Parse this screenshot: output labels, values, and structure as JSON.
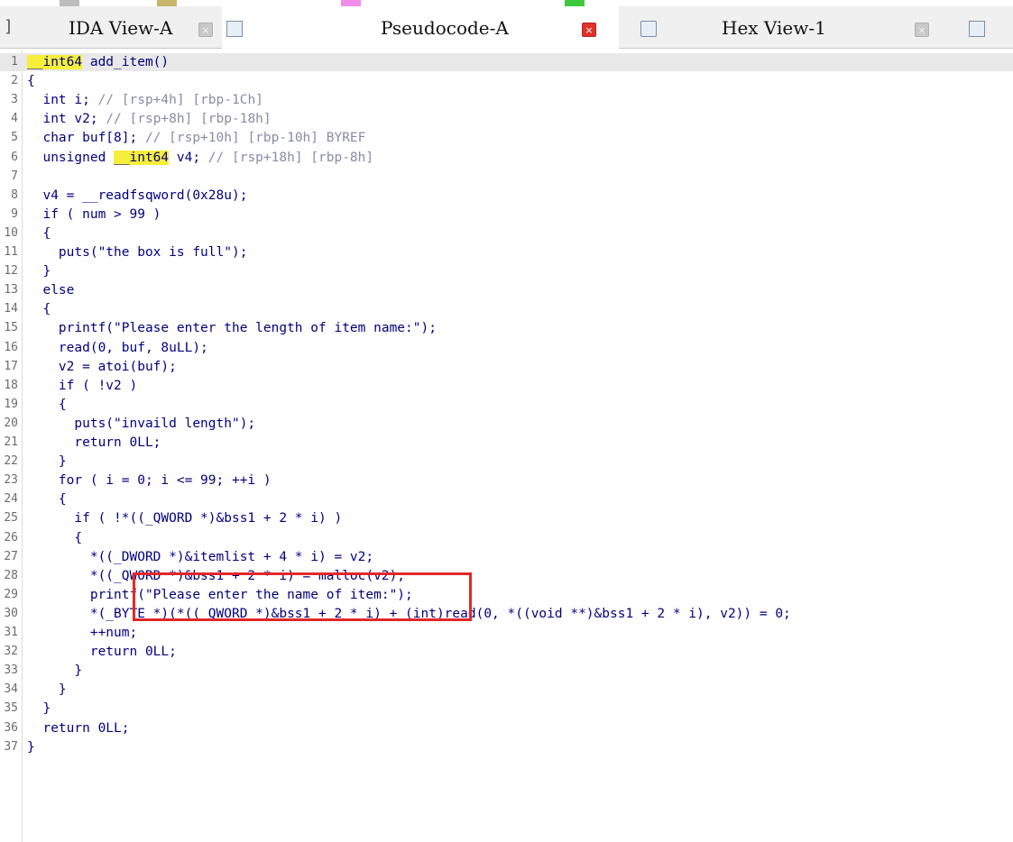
{
  "tabs": [
    {
      "label": "IDA View-A",
      "active": false,
      "close": "×"
    },
    {
      "label": "Pseudocode-A",
      "active": true,
      "close": "×"
    },
    {
      "label": "Hex View-1",
      "active": false,
      "close": "×"
    }
  ],
  "colors": {
    "accent_close": "#e0322a",
    "highlight": "#f5ee3a",
    "code_text": "#000080",
    "comment": "#8a8aa8",
    "annotation_box": "#e22828"
  },
  "code_lines": [
    {
      "num": "1",
      "text": "__int64 add_item()"
    },
    {
      "num": "2",
      "text": "{"
    },
    {
      "num": "3",
      "text": "  int i; // [rsp+4h] [rbp-1Ch]"
    },
    {
      "num": "4",
      "text": "  int v2; // [rsp+8h] [rbp-18h]"
    },
    {
      "num": "5",
      "text": "  char buf[8]; // [rsp+10h] [rbp-10h] BYREF"
    },
    {
      "num": "6",
      "text": "  unsigned __int64 v4; // [rsp+18h] [rbp-8h]"
    },
    {
      "num": "7",
      "text": ""
    },
    {
      "num": "8",
      "text": "  v4 = __readfsqword(0x28u);"
    },
    {
      "num": "9",
      "text": "  if ( num > 99 )"
    },
    {
      "num": "10",
      "text": "  {"
    },
    {
      "num": "11",
      "text": "    puts(\"the box is full\");"
    },
    {
      "num": "12",
      "text": "  }"
    },
    {
      "num": "13",
      "text": "  else"
    },
    {
      "num": "14",
      "text": "  {"
    },
    {
      "num": "15",
      "text": "    printf(\"Please enter the length of item name:\");"
    },
    {
      "num": "16",
      "text": "    read(0, buf, 8uLL);"
    },
    {
      "num": "17",
      "text": "    v2 = atoi(buf);"
    },
    {
      "num": "18",
      "text": "    if ( !v2 )"
    },
    {
      "num": "19",
      "text": "    {"
    },
    {
      "num": "20",
      "text": "      puts(\"invaild length\");"
    },
    {
      "num": "21",
      "text": "      return 0LL;"
    },
    {
      "num": "22",
      "text": "    }"
    },
    {
      "num": "23",
      "text": "    for ( i = 0; i <= 99; ++i )"
    },
    {
      "num": "24",
      "text": "    {"
    },
    {
      "num": "25",
      "text": "      if ( !*((_QWORD *)&bss1 + 2 * i) )"
    },
    {
      "num": "26",
      "text": "      {"
    },
    {
      "num": "27",
      "text": "        *((_DWORD *)&itemlist + 4 * i) = v2;"
    },
    {
      "num": "28",
      "text": "        *((_QWORD *)&bss1 + 2 * i) = malloc(v2);"
    },
    {
      "num": "29",
      "text": "        printf(\"Please enter the name of item:\");"
    },
    {
      "num": "30",
      "text": "        *(_BYTE *)(*((_QWORD *)&bss1 + 2 * i) + (int)read(0, *((void **)&bss1 + 2 * i), v2)) = 0;"
    },
    {
      "num": "31",
      "text": "        ++num;"
    },
    {
      "num": "32",
      "text": "        return 0LL;"
    },
    {
      "num": "33",
      "text": "      }"
    },
    {
      "num": "34",
      "text": "    }"
    },
    {
      "num": "35",
      "text": "  }"
    },
    {
      "num": "36",
      "text": "  return 0LL;"
    },
    {
      "num": "37",
      "text": "}"
    }
  ]
}
